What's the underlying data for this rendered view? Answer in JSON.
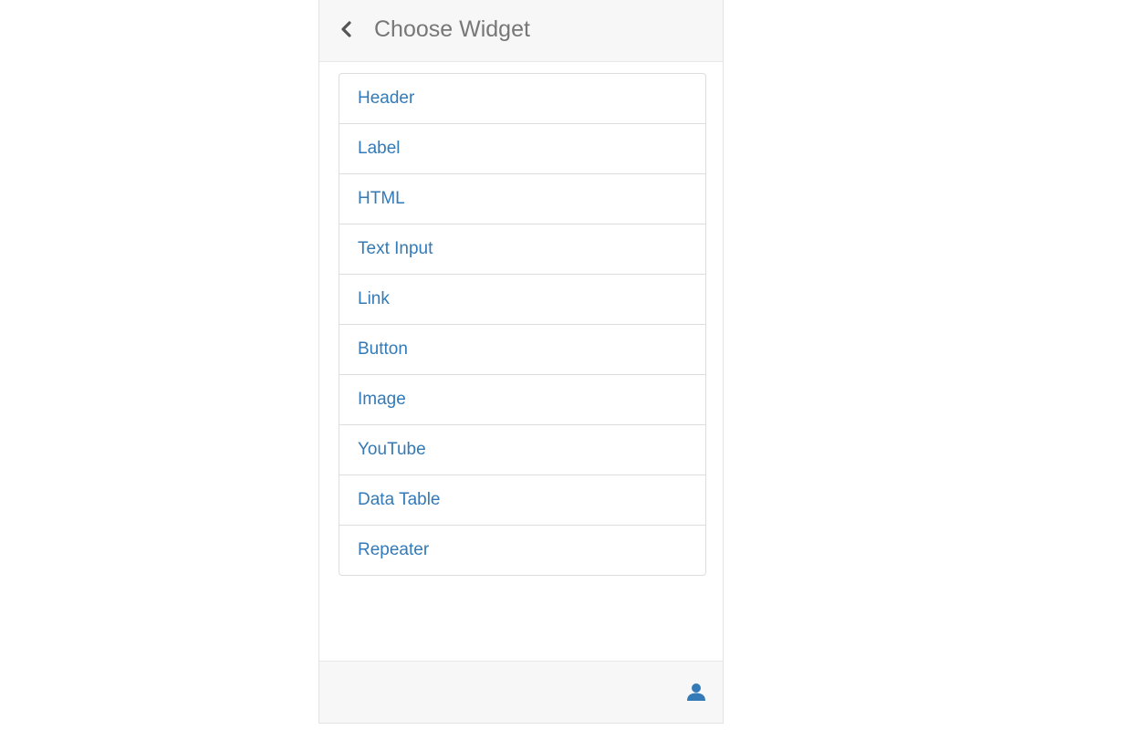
{
  "header": {
    "title": "Choose Widget",
    "back_icon": "chevron-left-icon"
  },
  "widgets": [
    {
      "label": "Header"
    },
    {
      "label": "Label"
    },
    {
      "label": "HTML"
    },
    {
      "label": "Text Input"
    },
    {
      "label": "Link"
    },
    {
      "label": "Button"
    },
    {
      "label": "Image"
    },
    {
      "label": "YouTube"
    },
    {
      "label": "Data Table"
    },
    {
      "label": "Repeater"
    }
  ],
  "footer": {
    "user_icon": "user-icon"
  },
  "colors": {
    "link": "#337ab7",
    "title": "#777777",
    "bar_background": "#f7f7f7",
    "border": "#dddddd"
  }
}
